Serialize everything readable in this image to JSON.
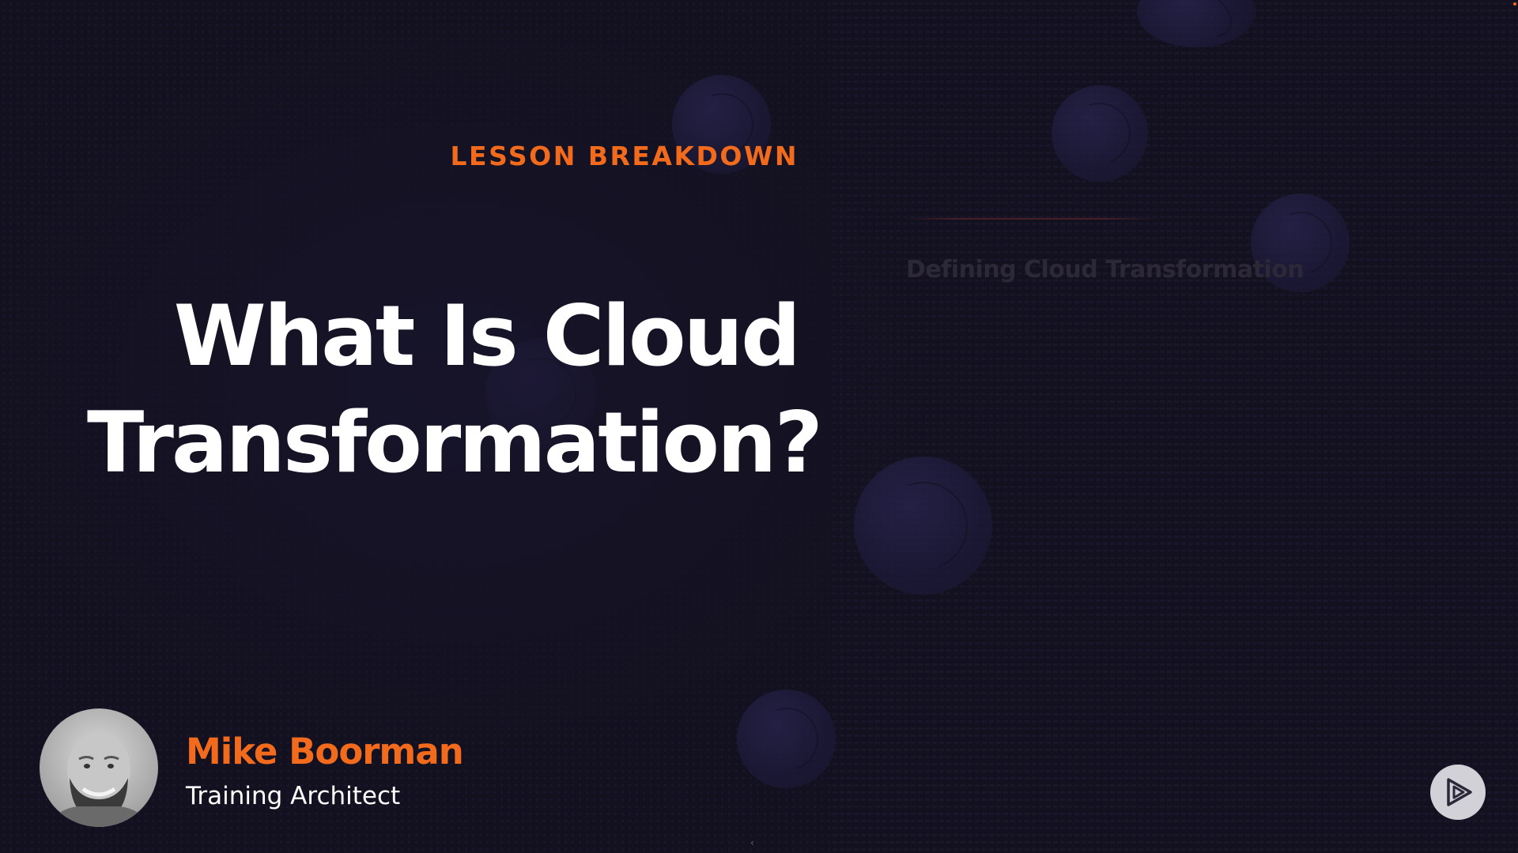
{
  "slide": {
    "eyebrow": "LESSON BREAKDOWN",
    "title_line1": "What Is Cloud",
    "title_line2": "Transformation?"
  },
  "agenda": {
    "items": [
      "Defining Cloud Transformation"
    ]
  },
  "presenter": {
    "name": "Mike Boorman",
    "role": "Training Architect"
  },
  "controls": {
    "logo_icon": "play-logo-icon",
    "collapse_icon": "chevron-left-icon",
    "collapse_glyph": "‹"
  },
  "colors": {
    "background": "#13111f",
    "accent": "#f26b1d",
    "title": "#ffffff",
    "agenda_dimmed": "#2c2838"
  }
}
